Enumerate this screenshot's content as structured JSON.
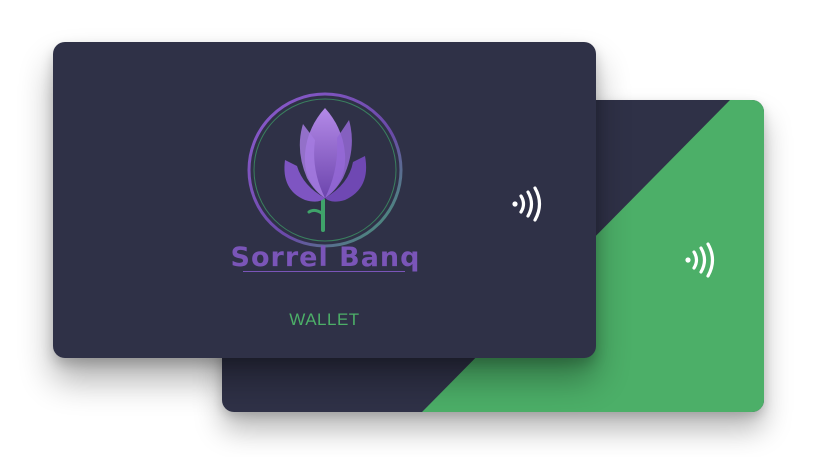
{
  "brand": {
    "name": "Sorrel Banq",
    "card_label": "WALLET"
  },
  "colors": {
    "card_background": "#2f3147",
    "accent_green": "#4caf68",
    "brand_purple": "#7a55b8"
  },
  "icons": {
    "logo": "tulip-logo-icon",
    "contactless": "contactless-icon"
  }
}
